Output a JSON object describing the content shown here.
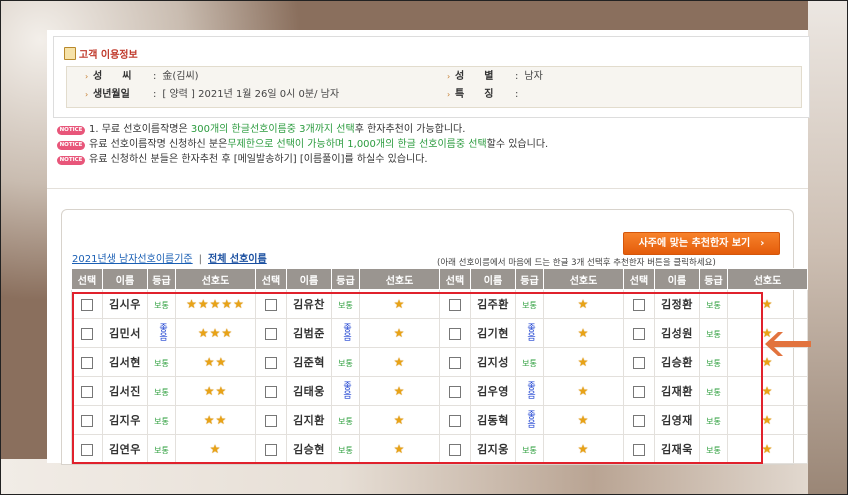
{
  "info": {
    "title": "고객 이용정보",
    "rows": [
      {
        "label": "성　　씨",
        "value": "金(김씨)"
      },
      {
        "label": "생년월일",
        "value": "[ 양력 ] 2021년 1월 26일 0시 0분/ 남자"
      },
      {
        "label": "성　　별",
        "value": "남자"
      },
      {
        "label": "특　　징",
        "value": ""
      }
    ]
  },
  "notices": {
    "tag": "NOTICE",
    "n1": {
      "a": "1. 무료 선호이름작명은 ",
      "b": "300개의 한글선호이름중 3개까지 선택",
      "c": "후 한자추천이 가능합니다."
    },
    "n2": {
      "a": "유료 선호이름작명 신청하신 분은",
      "b": "무제한으로 선택이 가능하며 1,000개의 한글 선호이름중 선택",
      "c": "할수 있습니다."
    },
    "n3": {
      "a": "유료 신청하신 분들은 한자추천 후 [메일발송하기] [이름풀이]를 하실수 있습니다."
    }
  },
  "list": {
    "link1": "2021년생 남자선호이름기준",
    "separator": "|",
    "link2": "전체 선호이름",
    "button": "사주에 맞는 추천한자 보기",
    "button_arrow": "›",
    "hint": "(아래 선호이름에서 마음에 드는 한글 3개 선택후 추천한자 버튼을 클릭하세요)",
    "headers": [
      "선택",
      "이름",
      "등급",
      "선호도"
    ],
    "rows": [
      [
        {
          "name": "김시우",
          "grade": "보통",
          "stars": "★★★★★"
        },
        {
          "name": "김유찬",
          "grade": "보통",
          "stars": "★"
        },
        {
          "name": "김주환",
          "grade": "보통",
          "stars": "★"
        },
        {
          "name": "김정환",
          "grade": "보통",
          "stars": "★"
        }
      ],
      [
        {
          "name": "김민서",
          "grade": "좋음",
          "stars": "★★★"
        },
        {
          "name": "김범준",
          "grade": "좋음",
          "stars": "★"
        },
        {
          "name": "김기현",
          "grade": "좋음",
          "stars": "★"
        },
        {
          "name": "김성원",
          "grade": "보통",
          "stars": "★"
        }
      ],
      [
        {
          "name": "김서현",
          "grade": "보통",
          "stars": "★★"
        },
        {
          "name": "김준혁",
          "grade": "보통",
          "stars": "★"
        },
        {
          "name": "김지성",
          "grade": "보통",
          "stars": "★"
        },
        {
          "name": "김승환",
          "grade": "보통",
          "stars": "★"
        }
      ],
      [
        {
          "name": "김서진",
          "grade": "보통",
          "stars": "★★"
        },
        {
          "name": "김태웅",
          "grade": "좋음",
          "stars": "★"
        },
        {
          "name": "김우영",
          "grade": "좋음",
          "stars": "★"
        },
        {
          "name": "김재환",
          "grade": "보통",
          "stars": "★"
        }
      ],
      [
        {
          "name": "김지우",
          "grade": "보통",
          "stars": "★★"
        },
        {
          "name": "김지환",
          "grade": "보통",
          "stars": "★"
        },
        {
          "name": "김동혁",
          "grade": "좋음",
          "stars": "★"
        },
        {
          "name": "김영재",
          "grade": "보통",
          "stars": "★"
        }
      ],
      [
        {
          "name": "김연우",
          "grade": "보통",
          "stars": "★"
        },
        {
          "name": "김승현",
          "grade": "보통",
          "stars": "★"
        },
        {
          "name": "김지웅",
          "grade": "보통",
          "stars": "★"
        },
        {
          "name": "김재욱",
          "grade": "보통",
          "stars": "★"
        }
      ]
    ]
  },
  "colors": {
    "accent": "#f26f1d",
    "highlight_box": "#e0212c",
    "arrow": "#e2733e",
    "grade_normal": "#2a9d3a",
    "grade_good": "#1a3fd0"
  }
}
